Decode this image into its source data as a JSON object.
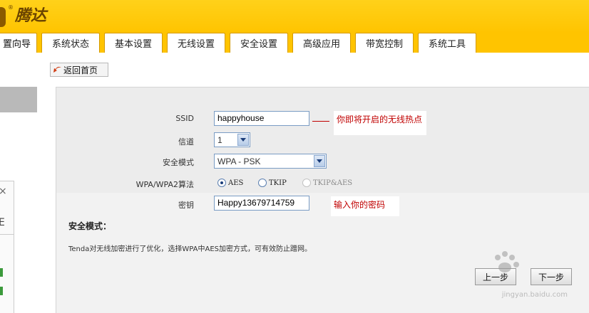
{
  "brand": {
    "name": "腾达",
    "reg_mark": "®"
  },
  "tabs": [
    {
      "label": "置向导",
      "active": true
    },
    {
      "label": "系统状态"
    },
    {
      "label": "基本设置"
    },
    {
      "label": "无线设置"
    },
    {
      "label": "安全设置"
    },
    {
      "label": "高级应用"
    },
    {
      "label": "带宽控制"
    },
    {
      "label": "系统工具"
    }
  ],
  "back_button": {
    "label": "返回首页",
    "icon": "back-arrow-icon"
  },
  "form": {
    "ssid": {
      "label": "SSID",
      "value": "happyhouse",
      "note": "你即将开启的无线热点"
    },
    "channel": {
      "label": "信道",
      "value": "1"
    },
    "security_mode": {
      "label": "安全模式",
      "value": "WPA - PSK"
    },
    "algorithm": {
      "label": "WPA/WPA2算法",
      "options": [
        {
          "label": "AES",
          "checked": true
        },
        {
          "label": "TKIP",
          "checked": false
        },
        {
          "label": "TKIP&AES",
          "checked": false,
          "disabled": true
        }
      ]
    },
    "password": {
      "label": "密钥",
      "value": "Happy13679714759",
      "note": "输入你的密码"
    }
  },
  "section": {
    "title": "安全模式：",
    "description": "Tenda对无线加密进行了优化，选择WPA中AES加密方式，可有效防止蹭网。"
  },
  "buttons": {
    "prev": "上一步",
    "next": "下一步"
  },
  "side": {
    "close_glyph": "×",
    "letter": "E"
  },
  "watermark": {
    "text": "jingyan.baidu.com"
  },
  "colors": {
    "brand_yellow": "#ffc400",
    "note_red": "#c00000",
    "field_border": "#7a9cc4"
  }
}
